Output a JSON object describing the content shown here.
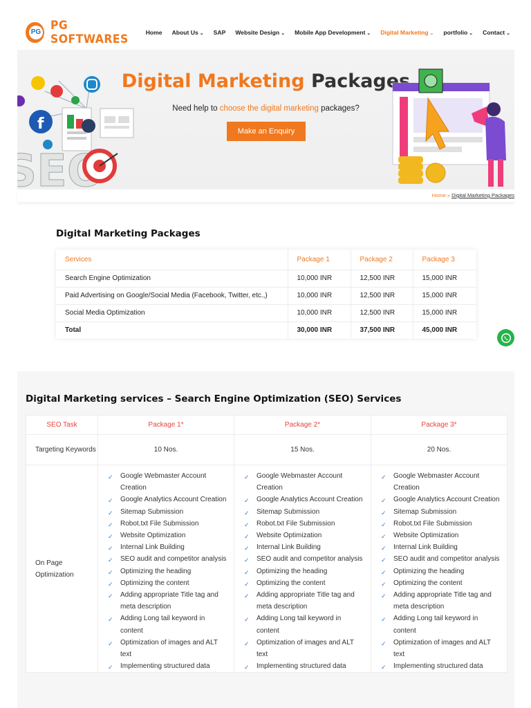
{
  "brand": {
    "logo_mark": "PG",
    "name": "PG SOFTWARES",
    "accent": "#f0781e"
  },
  "nav": [
    {
      "label": "Home",
      "caret": false,
      "active": false
    },
    {
      "label": "About Us",
      "caret": true,
      "active": false
    },
    {
      "label": "SAP",
      "caret": false,
      "active": false
    },
    {
      "label": "Website Design",
      "caret": true,
      "active": false
    },
    {
      "label": "Mobile App Development",
      "caret": true,
      "active": false
    },
    {
      "label": "Digital Marketing",
      "caret": true,
      "active": true
    },
    {
      "label": "portfolio",
      "caret": true,
      "active": false
    },
    {
      "label": "Contact",
      "caret": true,
      "active": false
    }
  ],
  "hero": {
    "title_highlight": "Digital Marketing",
    "title_rest": " Packages",
    "sub_before": "Need help to ",
    "sub_link": "choose the digital marketing",
    "sub_after": " packages?",
    "button": "Make an Enquiry",
    "seo_word": "SEO"
  },
  "breadcrumb": {
    "home": "Home",
    "sep": " » ",
    "current": "Digital Marketing Packages"
  },
  "packages": {
    "title": "Digital Marketing Packages",
    "headers": [
      "Services",
      "Package 1",
      "Package 2",
      "Package 3"
    ],
    "rows": [
      [
        "Search Engine Optimization",
        "10,000 INR",
        "12,500 INR",
        "15,000 INR"
      ],
      [
        "Paid Advertising on Google/Social Media (Facebook, Twitter, etc.,)",
        "10,000 INR",
        "12,500 INR",
        "15,000 INR"
      ],
      [
        "Social Media Optimization",
        "10,000 INR",
        "12,500 INR",
        "15,000 INR"
      ]
    ],
    "total": [
      "Total",
      "30,000 INR",
      "37,500 INR",
      "45,000 INR"
    ]
  },
  "seo": {
    "title": "Digital Marketing services – Search Engine Optimization (SEO) Services",
    "headers": [
      "SEO Task",
      "Package 1*",
      "Package 2*",
      "Package 3*"
    ],
    "keywords_label": "Targeting Keywords",
    "keywords": [
      "10 Nos.",
      "15 Nos.",
      "20 Nos."
    ],
    "onpage_label": "On Page Optimization",
    "onpage_items": [
      "Google Webmaster Account Creation",
      "Google Analytics Account Creation",
      "Sitemap Submission",
      "Robot.txt File Submission",
      "Website Optimization",
      "Internal Link Building",
      "SEO audit and competitor analysis",
      "Optimizing the heading",
      "Optimizing the content",
      "Adding appropriate Title tag and meta description",
      "Adding Long tail keyword in content",
      "Optimization of images and ALT text",
      "Implementing structured data"
    ]
  }
}
